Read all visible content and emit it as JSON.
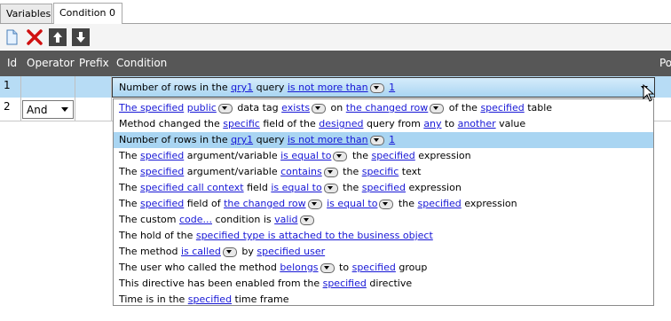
{
  "tabs": [
    {
      "label": "Variables"
    },
    {
      "label": "Condition 0"
    }
  ],
  "toolbar": {
    "buttons": [
      {
        "icon": "new-document-icon"
      },
      {
        "icon": "delete-x-icon"
      },
      {
        "icon": "arrow-up-icon"
      },
      {
        "icon": "arrow-down-icon"
      }
    ]
  },
  "table": {
    "columns": [
      "Id",
      "Operator",
      "Prefix",
      "Condition",
      "Po"
    ],
    "rows": [
      {
        "id": "1",
        "operator": "",
        "selected": true
      },
      {
        "id": "2",
        "operator": "And"
      }
    ]
  },
  "combo": {
    "segments": [
      {
        "t": "Number of rows in the "
      },
      {
        "t": "qry1",
        "link": true
      },
      {
        "t": " query "
      },
      {
        "t": "is not more than",
        "link": true
      },
      {
        "dd": true
      },
      {
        "t": " "
      },
      {
        "t": "1",
        "link": true
      }
    ]
  },
  "dropdown_items": [
    [
      {
        "t": "The specified",
        "link": true
      },
      {
        "t": " "
      },
      {
        "t": "public",
        "link": true
      },
      {
        "dd": true
      },
      {
        "t": " data tag "
      },
      {
        "t": "exists",
        "link": true
      },
      {
        "dd": true
      },
      {
        "t": " on "
      },
      {
        "t": "the changed row",
        "link": true
      },
      {
        "dd": true
      },
      {
        "t": " of the "
      },
      {
        "t": "specified",
        "link": true
      },
      {
        "t": " table"
      }
    ],
    [
      {
        "t": "Method changed the "
      },
      {
        "t": "specific",
        "link": true
      },
      {
        "t": " field of the "
      },
      {
        "t": "designed",
        "link": true
      },
      {
        "t": " query from "
      },
      {
        "t": "any",
        "link": true
      },
      {
        "t": " to "
      },
      {
        "t": "another",
        "link": true
      },
      {
        "t": " value"
      }
    ],
    [
      {
        "t": "Number of rows in the "
      },
      {
        "t": "qry1",
        "link": true
      },
      {
        "t": " query "
      },
      {
        "t": "is not more than",
        "link": true
      },
      {
        "dd": true
      },
      {
        "t": " "
      },
      {
        "t": "1",
        "link": true
      }
    ],
    [
      {
        "t": "The "
      },
      {
        "t": "specified",
        "link": true
      },
      {
        "t": " argument/variable "
      },
      {
        "t": "is equal to",
        "link": true
      },
      {
        "dd": true
      },
      {
        "t": " the "
      },
      {
        "t": "specified",
        "link": true
      },
      {
        "t": " expression"
      }
    ],
    [
      {
        "t": "The "
      },
      {
        "t": "specified",
        "link": true
      },
      {
        "t": " argument/variable "
      },
      {
        "t": "contains",
        "link": true
      },
      {
        "dd": true
      },
      {
        "t": " the "
      },
      {
        "t": "specific",
        "link": true
      },
      {
        "t": " text"
      }
    ],
    [
      {
        "t": "The "
      },
      {
        "t": "specified call context",
        "link": true
      },
      {
        "t": " field "
      },
      {
        "t": "is equal to",
        "link": true
      },
      {
        "dd": true
      },
      {
        "t": " the "
      },
      {
        "t": "specified",
        "link": true
      },
      {
        "t": " expression"
      }
    ],
    [
      {
        "t": "The "
      },
      {
        "t": "specified",
        "link": true
      },
      {
        "t": " field of "
      },
      {
        "t": "the changed row",
        "link": true
      },
      {
        "dd": true
      },
      {
        "t": " "
      },
      {
        "t": "is equal to",
        "link": true
      },
      {
        "dd": true
      },
      {
        "t": " the "
      },
      {
        "t": "specified",
        "link": true
      },
      {
        "t": " expression"
      }
    ],
    [
      {
        "t": "The custom "
      },
      {
        "t": "code...",
        "link": true
      },
      {
        "t": " condition is "
      },
      {
        "t": "valid",
        "link": true
      },
      {
        "dd": true
      }
    ],
    [
      {
        "t": "The hold of the "
      },
      {
        "t": "specified type is attached to the business object",
        "link": true
      }
    ],
    [
      {
        "t": "The method "
      },
      {
        "t": "is called",
        "link": true
      },
      {
        "dd": true
      },
      {
        "t": " by "
      },
      {
        "t": "specified user",
        "link": true
      }
    ],
    [
      {
        "t": "The user who called the method "
      },
      {
        "t": "belongs",
        "link": true
      },
      {
        "dd": true
      },
      {
        "t": " to "
      },
      {
        "t": "specified",
        "link": true
      },
      {
        "t": " group"
      }
    ],
    [
      {
        "t": "This directive has been enabled from the "
      },
      {
        "t": "specified",
        "link": true
      },
      {
        "t": " directive"
      }
    ],
    [
      {
        "t": "Time is in the "
      },
      {
        "t": "specified",
        "link": true
      },
      {
        "t": " time frame"
      }
    ]
  ],
  "selected_item_index": 2,
  "colors": {
    "header_bg": "#575757",
    "selection_bg": "#a9d5f2",
    "link": "#1717d6"
  }
}
